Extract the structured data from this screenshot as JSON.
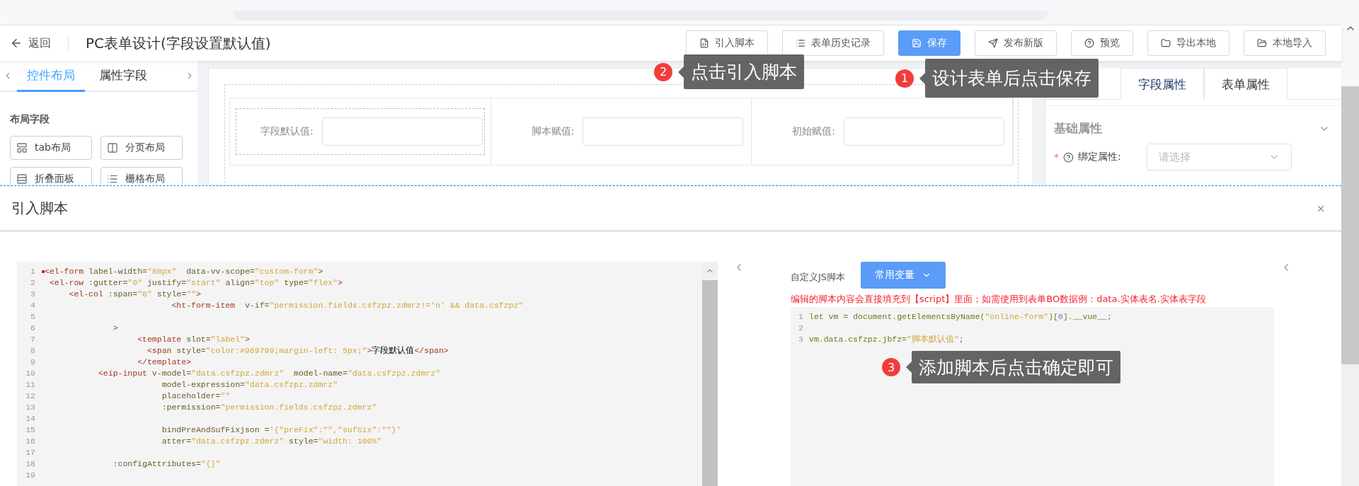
{
  "header": {
    "back": "返回",
    "title": "PC表单设计(字段设置默认值)",
    "buttons": [
      {
        "label": "引入脚本",
        "primary": false
      },
      {
        "label": "表单历史记录",
        "primary": false
      },
      {
        "label": "保存",
        "primary": true
      },
      {
        "label": "发布新版",
        "primary": false
      },
      {
        "label": "预览",
        "primary": false
      },
      {
        "label": "导出本地",
        "primary": false
      },
      {
        "label": "本地导入",
        "primary": false
      }
    ]
  },
  "left_panel": {
    "tabs": [
      {
        "label": "控件布局",
        "selected": true
      },
      {
        "label": "属性字段",
        "selected": false
      }
    ],
    "section_title": "布局字段",
    "items": [
      "tab布局",
      "分页布局",
      "折叠面板",
      "栅格布局"
    ]
  },
  "canvas": {
    "fields": [
      {
        "label": "字段默认值:",
        "selected": true
      },
      {
        "label": "脚本赋值:",
        "selected": false
      },
      {
        "label": "初始赋值:",
        "selected": false
      }
    ]
  },
  "right_panel": {
    "tabs": [
      {
        "label": "字段属性",
        "selected": true
      },
      {
        "label": "表单属性",
        "selected": false
      }
    ],
    "section_title": "基础属性",
    "field": {
      "required_mark": "*",
      "label": "绑定属性:",
      "placeholder": "请选择"
    }
  },
  "drawer": {
    "title": "引入脚本",
    "template_code": [
      {
        "no": "1",
        "fold_marker": true,
        "text": "<el-form label-width=\"80px\"  data-vv-scope=\"custom-form\">"
      },
      {
        "no": "2",
        "fold_marker": false,
        "text": " <el-row :gutter=\"0\" justify=\"start\" align=\"top\" type=\"flex\">"
      },
      {
        "no": "3",
        "fold_marker": false,
        "text": "     <el-col :span=\"8\" style=\"\">"
      },
      {
        "no": "4",
        "fold_marker": false,
        "text": "                          <ht-form-item  v-if=\"permission.fields.csfzpz.zdmrz!='n' && data.csfzpz\""
      },
      {
        "no": "5",
        "fold_marker": false
      },
      {
        "no": "6",
        "fold_marker": false,
        "text": "              >"
      },
      {
        "no": "7",
        "fold_marker": false,
        "text": "                   <template slot=\"label\">"
      },
      {
        "no": "8",
        "fold_marker": false,
        "text": "                     <span style=\"color:#969799;margin-left: 5px;\">字段默认值</span>"
      },
      {
        "no": "9",
        "fold_marker": false,
        "text": "                   </template>"
      },
      {
        "no": "10",
        "fold_marker": false,
        "text": "           <eip-input v-model=\"data.csfzpz.zdmrz\"  model-name=\"data.csfzpz.zdmrz\""
      },
      {
        "no": "11",
        "fold_marker": false,
        "text": "                        model-expression=\"data.csfzpz.zdmrz\""
      },
      {
        "no": "12",
        "fold_marker": false,
        "text": "                        placeholder=\"\""
      },
      {
        "no": "13",
        "fold_marker": false,
        "text": "                        :permission=\"permission.fields.csfzpz.zdmrz\""
      },
      {
        "no": "14",
        "fold_marker": false
      },
      {
        "no": "15",
        "fold_marker": false,
        "text": "                        bindPreAndSufFixjson ='{\"preFix\":\"\",\"sufSix\":\"\"}'"
      },
      {
        "no": "16",
        "fold_marker": false,
        "text": "                        atter=\"data.csfzpz.zdmrz\" style=\"width: 100%\""
      },
      {
        "no": "17",
        "fold_marker": false
      },
      {
        "no": "18",
        "fold_marker": false,
        "text": "              :configAttributes=\"{}\""
      },
      {
        "no": "19",
        "fold_marker": false
      }
    ],
    "script": {
      "label": "自定义JS脚本",
      "variables_button": "常用变量",
      "hint": "编辑的脚本内容会直接填充到【script】里面；如需使用到表单BO数据例：data.实体表名.实体表字段",
      "code": [
        {
          "no": "1",
          "text": "let vm = document.getElementsByName(\"online-form\")[0].__vue__;"
        },
        {
          "no": "2"
        },
        {
          "no": "3",
          "text": "vm.data.csfzpz.jbfz=\"脚本默认值\";"
        }
      ]
    }
  },
  "callouts": [
    {
      "number": "2",
      "text": "点击引入脚本"
    },
    {
      "number": "1",
      "text": "设计表单后点击保存"
    },
    {
      "number": "3",
      "text": "添加脚本后点击确定即可"
    }
  ]
}
